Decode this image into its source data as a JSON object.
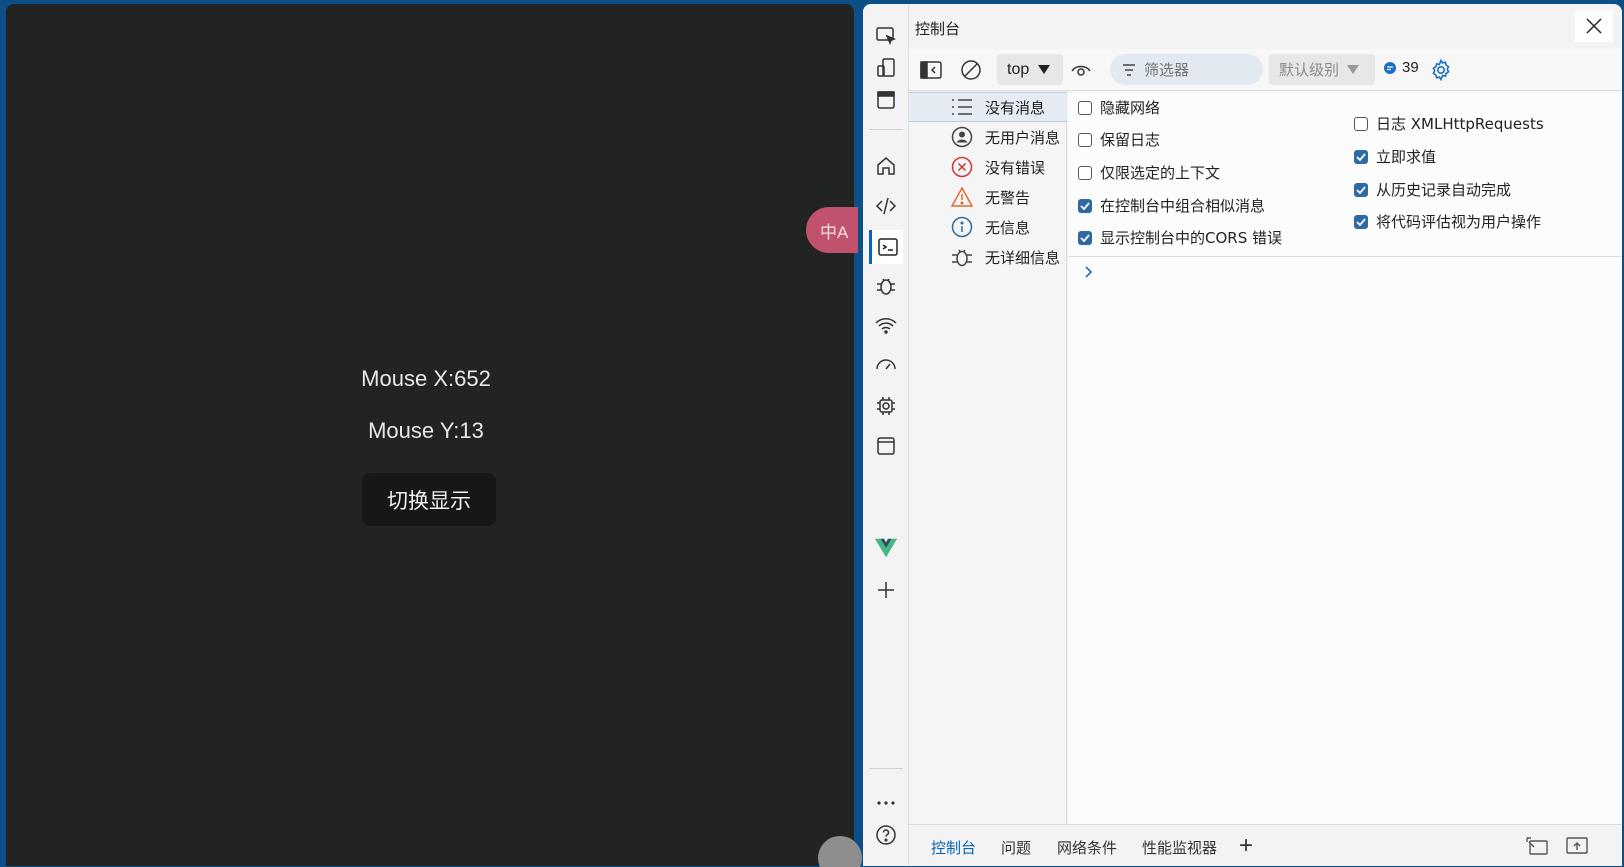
{
  "page": {
    "mouse_x": "Mouse X:652",
    "mouse_y": "Mouse Y:13",
    "toggle_button": "切换显示",
    "translate_badge": "中A"
  },
  "devtools": {
    "title": "控制台",
    "toolbar": {
      "context": "top",
      "filter_placeholder": "筛选器",
      "level": "默认级别",
      "issue_count": "39"
    },
    "sidebar": [
      {
        "label": "没有消息",
        "icon": "list-icon"
      },
      {
        "label": "无用户消息",
        "icon": "user-icon"
      },
      {
        "label": "没有错误",
        "icon": "error-icon"
      },
      {
        "label": "无警告",
        "icon": "warning-icon"
      },
      {
        "label": "无信息",
        "icon": "info-icon"
      },
      {
        "label": "无详细信息",
        "icon": "bug-icon"
      }
    ],
    "settings_left": [
      {
        "label": "隐藏网络",
        "checked": false
      },
      {
        "label": "保留日志",
        "checked": false
      },
      {
        "label": "仅限选定的上下文",
        "checked": false
      },
      {
        "label": "在控制台中组合相似消息",
        "checked": true
      },
      {
        "label": "显示控制台中的CORS 错误",
        "checked": true
      }
    ],
    "settings_right": [
      {
        "label": "日志 XMLHttpRequests",
        "checked": false
      },
      {
        "label": "立即求值",
        "checked": true
      },
      {
        "label": "从历史记录自动完成",
        "checked": true
      },
      {
        "label": "将代码评估视为用户操作",
        "checked": true
      }
    ],
    "drawer_tabs": [
      "控制台",
      "问题",
      "网络条件",
      "性能监视器"
    ],
    "colors": {
      "accent": "#0a62b4",
      "checkbox": "#2f6aa5",
      "page_bg": "#222323",
      "frame": "#0b4f86"
    }
  }
}
